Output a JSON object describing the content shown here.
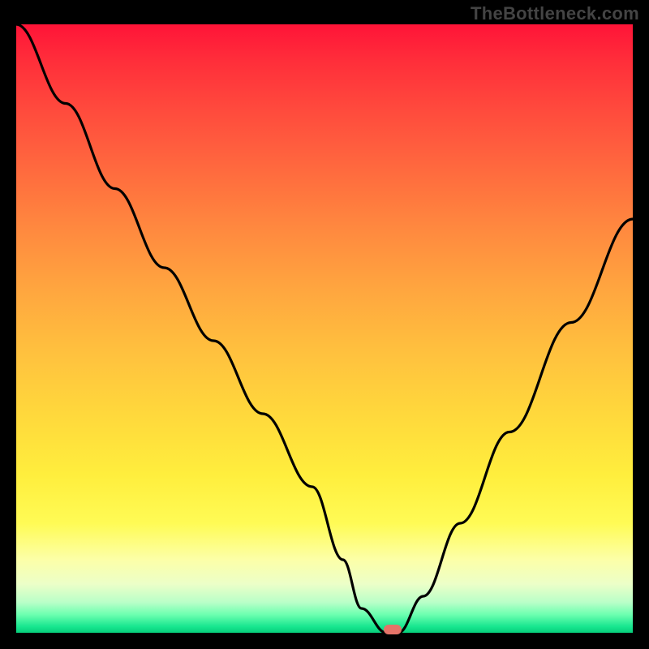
{
  "watermark": "TheBottleneck.com",
  "chart_data": {
    "type": "line",
    "title": "",
    "xlabel": "",
    "ylabel": "",
    "xlim": [
      0,
      100
    ],
    "ylim": [
      0,
      100
    ],
    "grid": false,
    "legend": false,
    "series": [
      {
        "name": "bottleneck-curve",
        "x": [
          0,
          8,
          16,
          24,
          32,
          40,
          48,
          53,
          56,
          60,
          62,
          66,
          72,
          80,
          90,
          100
        ],
        "values": [
          100,
          87,
          73,
          60,
          48,
          36,
          24,
          12,
          4,
          0,
          0,
          6,
          18,
          33,
          51,
          68
        ]
      }
    ],
    "annotations": [
      {
        "name": "optimal-marker",
        "x": 61,
        "y": 0
      }
    ],
    "background_gradient": {
      "stops": [
        {
          "pos": 0,
          "color": "#ff1438"
        },
        {
          "pos": 50,
          "color": "#ffc13e"
        },
        {
          "pos": 85,
          "color": "#fcffa8"
        },
        {
          "pos": 100,
          "color": "#07ce7b"
        }
      ]
    }
  }
}
